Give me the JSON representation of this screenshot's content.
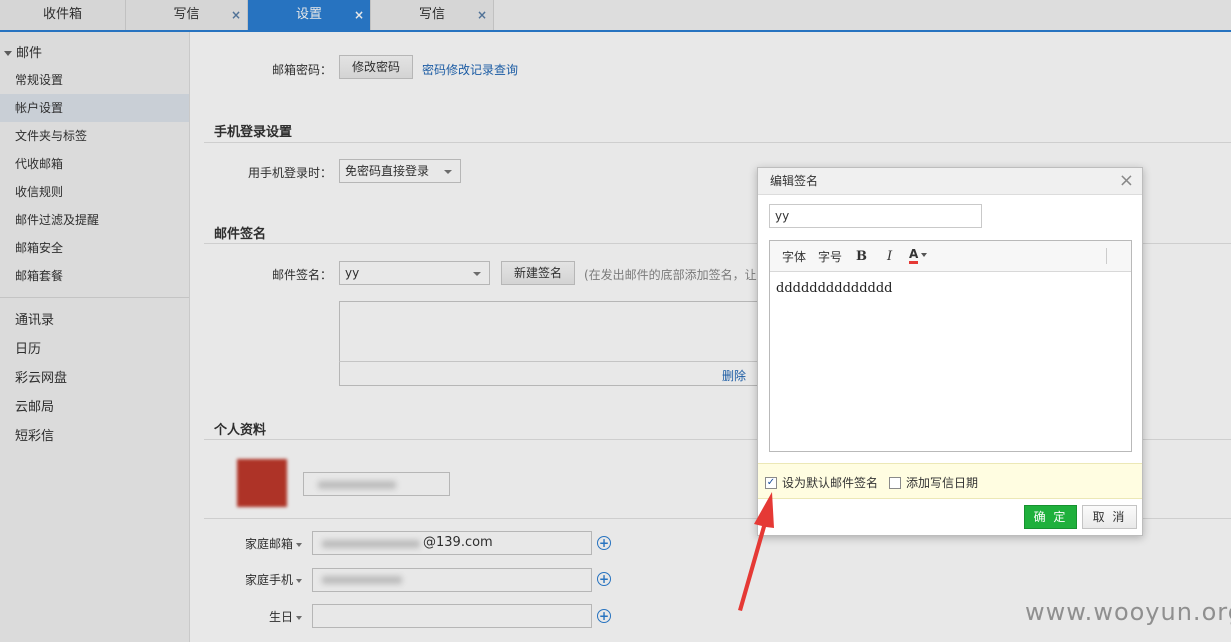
{
  "tabs": [
    {
      "label": "收件箱",
      "closable": false,
      "active": false
    },
    {
      "label": "写信",
      "closable": true,
      "active": false
    },
    {
      "label": "设置",
      "closable": true,
      "active": true
    },
    {
      "label": "写信",
      "closable": true,
      "active": false
    }
  ],
  "tab_close_glyph": "×",
  "sidebar": {
    "group_label": "邮件",
    "items": [
      "常规设置",
      "帐户设置",
      "文件夹与标签",
      "代收邮箱",
      "收信规则",
      "邮件过滤及提醒",
      "邮箱安全",
      "邮箱套餐"
    ],
    "active_item": "帐户设置",
    "apps": [
      "通讯录",
      "日历",
      "彩云网盘",
      "云邮局",
      "短彩信"
    ]
  },
  "main": {
    "password": {
      "label": "邮箱密码：",
      "change_button": "修改密码",
      "history_link": "密码修改记录查询"
    },
    "mobile_login": {
      "title": "手机登录设置",
      "label": "用手机登录时：",
      "selected": "免密码直接登录"
    },
    "signature": {
      "title": "邮件签名",
      "label": "邮件签名：",
      "selected": "yy",
      "new_button": "新建签名",
      "hint": "(在发出邮件的底部添加签名，让",
      "delete_link": "删除"
    },
    "profile": {
      "title": "个人资料",
      "email_label": "家庭邮箱",
      "email_value": "@139.com",
      "phone_label": "家庭手机",
      "birthday_label": "生日"
    }
  },
  "dialog": {
    "title": "编辑签名",
    "close_glyph": "×",
    "name_value": "yy",
    "toolbar": {
      "font": "字体",
      "size": "字号",
      "bold": "B",
      "italic": "I",
      "color": "A"
    },
    "body_text": "dddddddddddddd",
    "options": {
      "default_label": "设为默认邮件签名",
      "default_checked": true,
      "date_label": "添加写信日期",
      "date_checked": false
    },
    "ok_label": "确 定",
    "cancel_label": "取 消"
  },
  "colors": {
    "accent": "#2b7fd4",
    "ok_green": "#1fb03c",
    "arrow_red": "#e53935",
    "link_blue": "#1f66b5"
  },
  "watermark": "www.wooyun.org"
}
